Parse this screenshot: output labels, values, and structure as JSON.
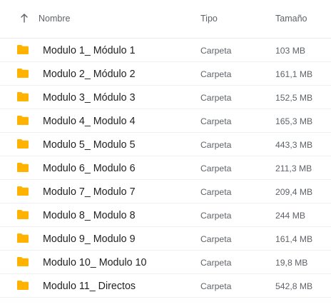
{
  "header": {
    "sort_icon": "arrow-up-icon",
    "name_label": "Nombre",
    "type_label": "Tipo",
    "size_label": "Tamaño"
  },
  "folder_icon_color": "#FFB300",
  "rows": [
    {
      "name": "Modulo 1_ Módulo 1",
      "type": "Carpeta",
      "size": "103 MB"
    },
    {
      "name": "Modulo 2_ Módulo 2",
      "type": "Carpeta",
      "size": "161,1 MB"
    },
    {
      "name": "Modulo 3_ Módulo 3",
      "type": "Carpeta",
      "size": "152,5 MB"
    },
    {
      "name": "Modulo 4_ Modulo 4",
      "type": "Carpeta",
      "size": "165,3 MB"
    },
    {
      "name": "Modulo 5_ Modulo 5",
      "type": "Carpeta",
      "size": "443,3 MB"
    },
    {
      "name": "Modulo 6_ Modulo 6",
      "type": "Carpeta",
      "size": "211,3 MB"
    },
    {
      "name": "Modulo 7_ Modulo 7",
      "type": "Carpeta",
      "size": "209,4 MB"
    },
    {
      "name": "Modulo 8_ Modulo 8",
      "type": "Carpeta",
      "size": "244 MB"
    },
    {
      "name": "Modulo 9_ Modulo 9",
      "type": "Carpeta",
      "size": "161,4 MB"
    },
    {
      "name": "Modulo 10_ Modulo 10",
      "type": "Carpeta",
      "size": "19,8 MB"
    },
    {
      "name": "Modulo 11_ Directos",
      "type": "Carpeta",
      "size": "542,8 MB"
    }
  ]
}
